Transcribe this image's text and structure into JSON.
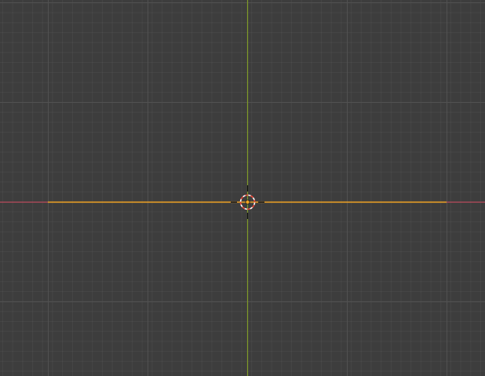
{
  "viewport": {
    "background_color": "#3d3d3d",
    "minor_grid_color": "#444444",
    "major_grid_color": "#505050",
    "x_axis_color": "#b74b5c",
    "y_axis_color": "#7f9a2a",
    "selected_edge_color": "#f5a623",
    "cursor_icon": "3d-cursor-icon",
    "cursor_ring_colors": [
      "#ffffff",
      "#e84a3c"
    ]
  }
}
